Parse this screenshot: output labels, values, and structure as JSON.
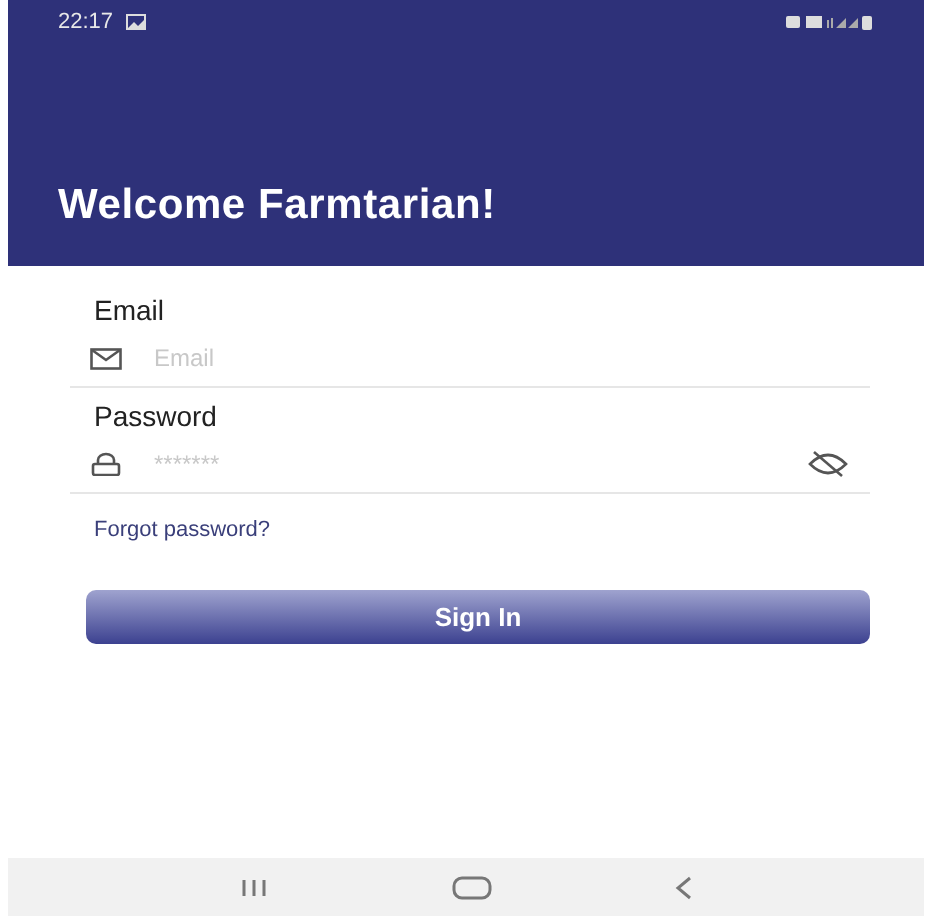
{
  "status_bar": {
    "time": "22:17"
  },
  "header": {
    "title": "Welcome Farmtarian!"
  },
  "form": {
    "fields": [
      {
        "kind": "email",
        "label": "Email",
        "placeholder": "Email"
      },
      {
        "kind": "password",
        "label": "Password",
        "placeholder": "*******"
      }
    ],
    "forgot_link": "Forgot password?",
    "submit_button": "Sign In"
  }
}
